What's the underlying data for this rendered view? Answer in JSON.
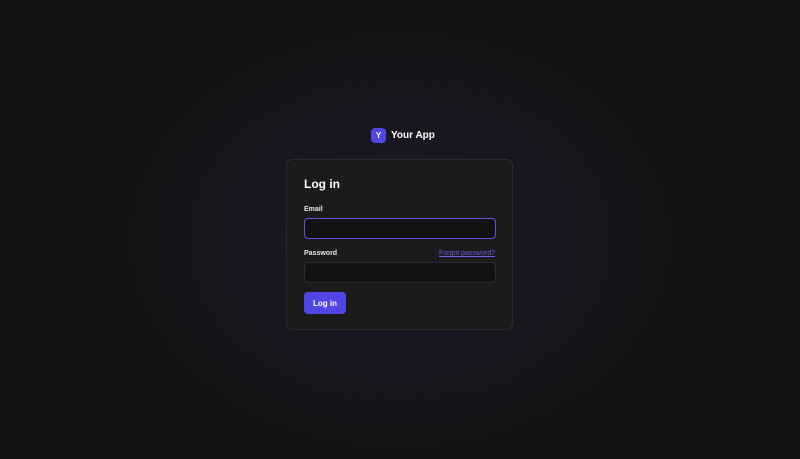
{
  "brand": {
    "logo_letter": "Y",
    "name": "Your App"
  },
  "login_form": {
    "title": "Log in",
    "email": {
      "label": "Email",
      "value": "",
      "placeholder": ""
    },
    "password": {
      "label": "Password",
      "value": "",
      "placeholder": ""
    },
    "forgot_password_link": "Forgot password?",
    "submit_label": "Log in"
  },
  "colors": {
    "accent": "#4f46e5",
    "link": "#6a5fe8",
    "background": "#141414",
    "card": "#1b1b1c"
  }
}
